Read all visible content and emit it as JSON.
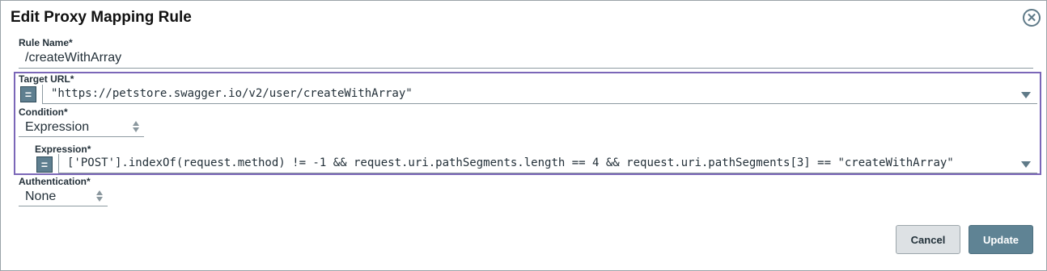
{
  "dialog": {
    "title": "Edit Proxy Mapping Rule",
    "close_icon": "close-circle-icon"
  },
  "fields": {
    "rule_name_label": "Rule Name*",
    "rule_name_value": "/createWithArray",
    "target_url_label": "Target URL*",
    "target_url_value": "\"https://petstore.swagger.io/v2/user/createWithArray\"",
    "condition_label": "Condition*",
    "condition_value": "Expression",
    "expression_label": "Expression*",
    "expression_value": "['POST'].indexOf(request.method) != -1 && request.uri.pathSegments.length == 4 && request.uri.pathSegments[3] == \"createWithArray\"",
    "authentication_label": "Authentication*",
    "authentication_value": "None",
    "expression_toggle_symbol": "="
  },
  "buttons": {
    "cancel": "Cancel",
    "update": "Update"
  }
}
